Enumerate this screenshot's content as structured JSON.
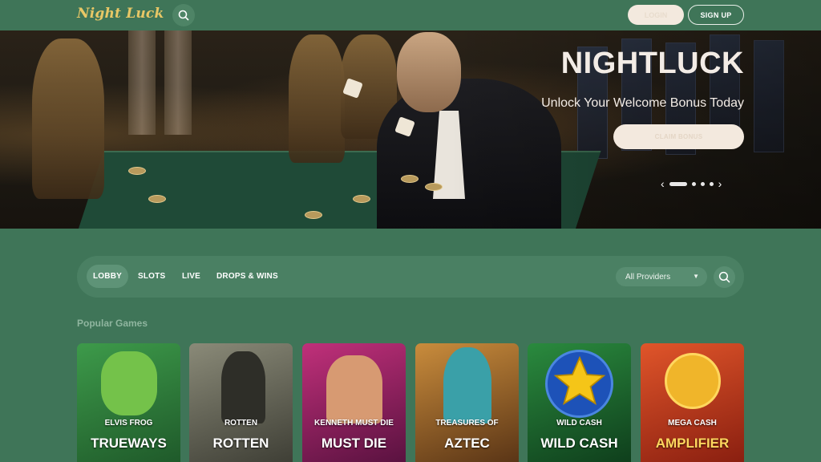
{
  "header": {
    "logo": "Night Luck",
    "login_label": "LOGIN",
    "signup_label": "SIGN UP"
  },
  "hero": {
    "title": "NIGHTLUCK",
    "subtitle": "Unlock Your Welcome Bonus Today",
    "cta_label": "CLAIM BONUS",
    "slides_total": 4,
    "active_slide": 1
  },
  "filters": {
    "tabs": [
      {
        "label": "LOBBY",
        "active": true
      },
      {
        "label": "SLOTS",
        "active": false
      },
      {
        "label": "LIVE",
        "active": false
      },
      {
        "label": "DROPS & WINS",
        "active": false
      }
    ],
    "provider_selected": "All Providers"
  },
  "section": {
    "title": "Popular Games"
  },
  "games": [
    {
      "small": "ELVIS FROG",
      "big": "TRUEWAYS",
      "bg": "#2f7a3c"
    },
    {
      "small": "ROTTEN",
      "big": "ROTTEN",
      "bg": "#5a5a4e"
    },
    {
      "small": "KENNETH MUST DIE",
      "big": "MUST DIE",
      "bg": "#7a1f5a"
    },
    {
      "small": "TREASURES OF",
      "big": "AZTEC",
      "bg": "#8a5a2a"
    },
    {
      "small": "WILD CASH",
      "big": "WILD CASH",
      "bg": "#1f5a2a"
    },
    {
      "small": "MEGA CASH",
      "big": "AMPLIFIER",
      "bg": "#b3361f"
    }
  ]
}
